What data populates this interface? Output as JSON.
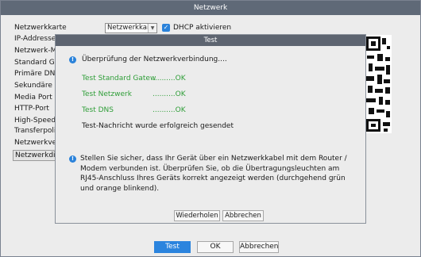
{
  "main": {
    "title": "Netzwerk",
    "labels": [
      "Netzwerkkarte",
      "IP-Addresse",
      "Netzwerk-M",
      "Standard Ga",
      "Primäre DNS",
      "Sekundäre D",
      "Media Port",
      "HTTP-Port",
      "High-Speed",
      "Transferpoli",
      "Netzwerkver",
      "Netzwerkdi"
    ],
    "network_card_value": "Netzwerkkai",
    "dhcp_label": "DHCP aktivieren",
    "dhcp_checked": true,
    "buttons": {
      "test": "Test",
      "ok": "OK",
      "cancel": "Abbrechen"
    }
  },
  "dialog": {
    "title": "Test",
    "checking_text": "Überprüfung der Netzwerkverbindung....",
    "results": [
      {
        "label": "Test Standard Gatew",
        "status": "..........OK"
      },
      {
        "label": "Test Netzwerk",
        "status": "..........OK"
      },
      {
        "label": "Test DNS",
        "status": "..........OK"
      }
    ],
    "success_message": "Test-Nachricht wurde erfolgreich gesendet",
    "hint_text": "Stellen Sie sicher, dass Ihr Gerät über ein Netzwerkkabel mit dem Router / Modem verbunden ist. Überprüfen Sie, ob die Übertragungsleuchten am RJ45-Anschluss Ihres Geräts korrekt angezeigt werden (durchgehend grün und orange blinkend).",
    "buttons": {
      "retry": "Wiederholen",
      "cancel": "Abbrechen"
    }
  },
  "colors": {
    "accent": "#2b84de",
    "success": "#2f9e38",
    "titlebar": "#5f6977"
  }
}
